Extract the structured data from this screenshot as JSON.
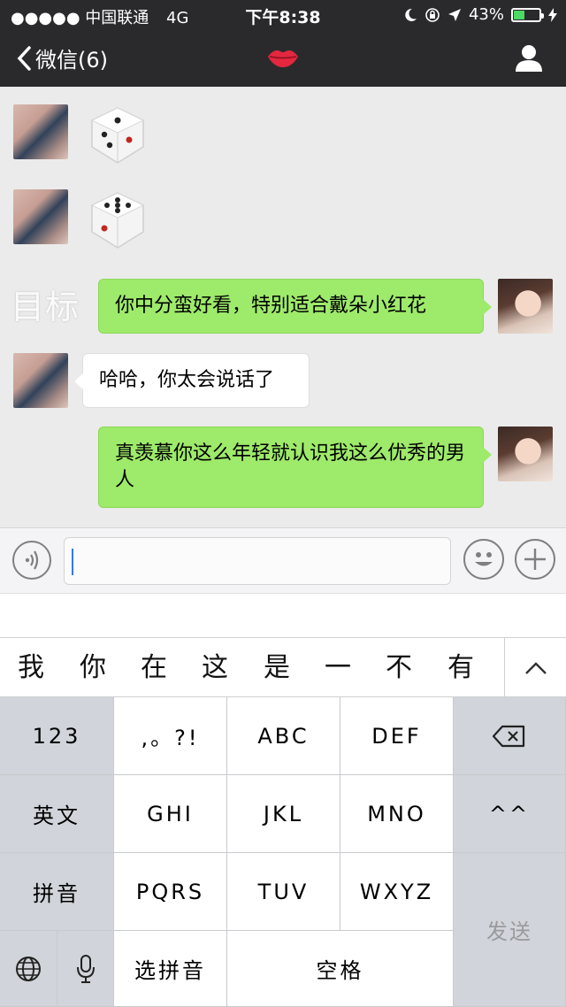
{
  "status_bar": {
    "carrier": "●●●●● 中国联通",
    "network": "4G",
    "time": "下午8:38",
    "battery_percent": "43%"
  },
  "nav": {
    "back_label": "微信(6)",
    "title_icon": "lips-emoji",
    "contact_icon": "person-icon"
  },
  "chat": {
    "target_label": "目标",
    "messages": [
      {
        "side": "left",
        "type": "dice",
        "face": 3
      },
      {
        "side": "left",
        "type": "dice",
        "face": 5
      },
      {
        "side": "right",
        "type": "text",
        "text": "你中分蛮好看，特别适合戴朵小红花"
      },
      {
        "side": "left",
        "type": "text",
        "text": "哈哈，你太会说话了"
      },
      {
        "side": "right",
        "type": "text",
        "text": "真羡慕你这么年轻就认识我这么优秀的男人"
      }
    ]
  },
  "input": {
    "value": ""
  },
  "candidates": [
    "我",
    "你",
    "在",
    "这",
    "是",
    "一",
    "不",
    "有"
  ],
  "keyboard": {
    "k_123": "123",
    "k_punct": ",。?!",
    "k_abc": "ABC",
    "k_def": "DEF",
    "k_en": "英文",
    "k_ghi": "GHI",
    "k_jkl": "JKL",
    "k_mno": "MNO",
    "k_face": "^^",
    "k_pinyin": "拼音",
    "k_pqrs": "PQRS",
    "k_tuv": "TUV",
    "k_wxyz": "WXYZ",
    "k_send": "发送",
    "k_select_pinyin": "选拼音",
    "k_space": "空格"
  },
  "colors": {
    "nav_bg": "#2a2a2d",
    "chat_bg": "#ebebeb",
    "green_bubble": "#9eea6a",
    "battery": "#4cd964",
    "caret": "#3478f6"
  }
}
